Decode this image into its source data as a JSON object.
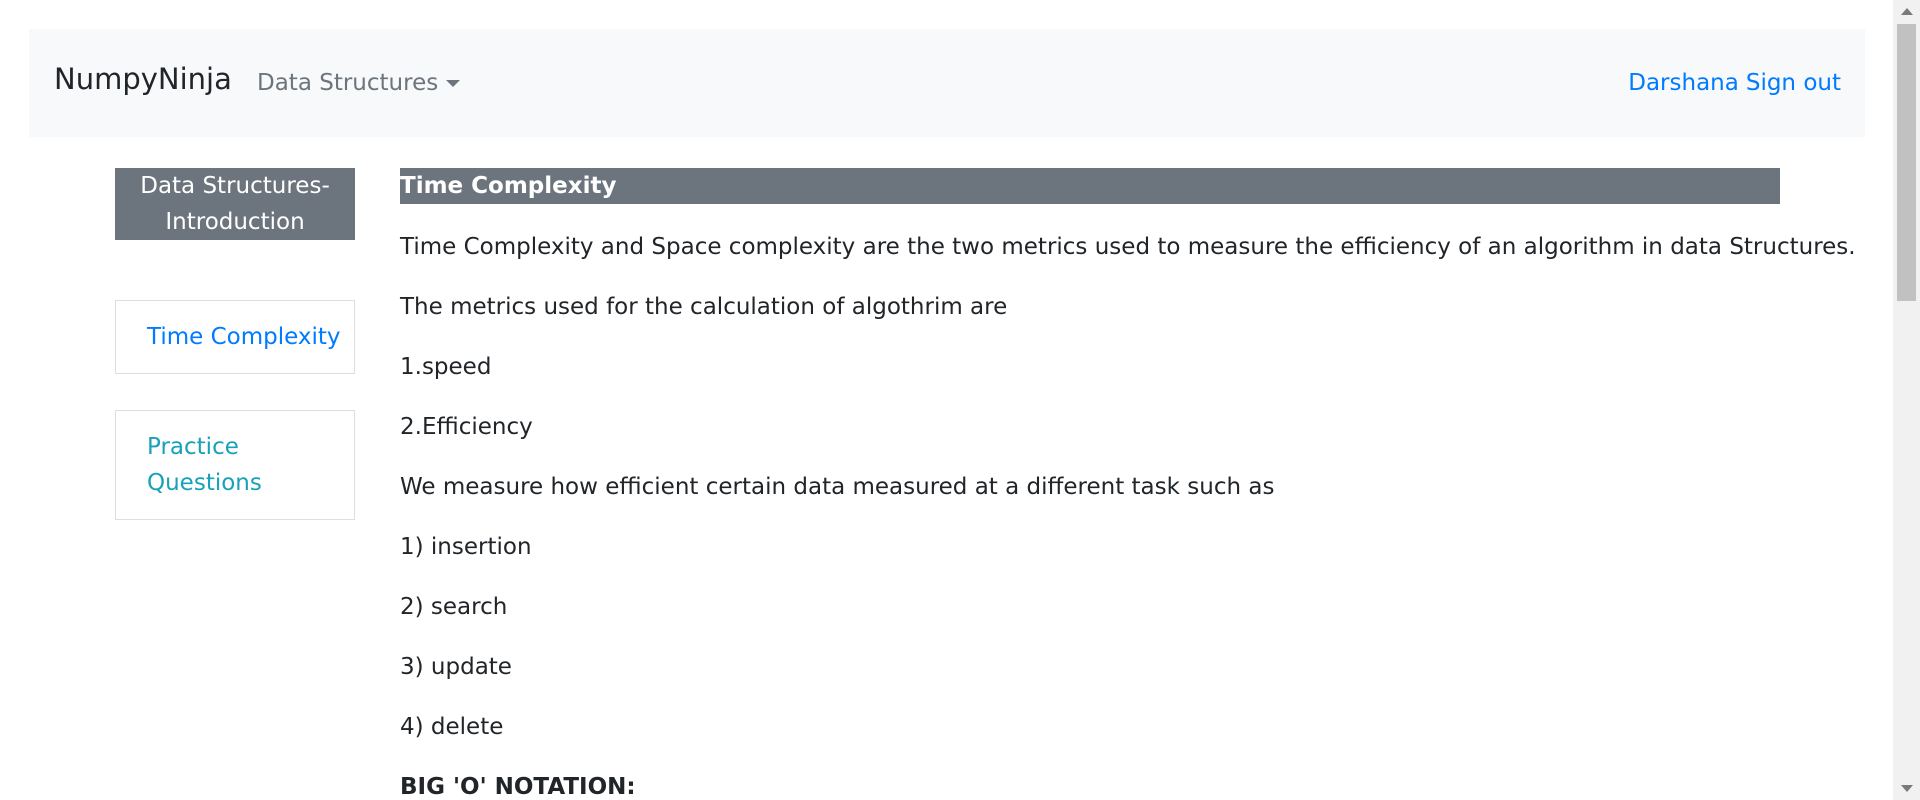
{
  "navbar": {
    "brand": "NumpyNinja",
    "dropdown_label": "Data Structures",
    "user_name": "Darshana",
    "sign_out": "Sign out"
  },
  "sidebar": {
    "header_line1": "Data Structures-",
    "header_line2": "Introduction",
    "items": [
      {
        "label": "Time Complexity"
      },
      {
        "label_line1": "Practice",
        "label_line2": "Questions"
      }
    ]
  },
  "content": {
    "title": "Time Complexity",
    "paragraphs": [
      "Time Complexity and Space complexity are the two metrics used to measure the efficiency of an algorithm in data Structures.",
      "The metrics used for the calculation of algothrim are",
      "1.speed",
      "2.Efficiency",
      "We measure how efficient certain data measured at a different task such as",
      "1) insertion",
      "2) search",
      "3) update",
      "4) delete",
      "BIG 'O' NOTATION:"
    ]
  },
  "colors": {
    "navbar_bg": "#f8f9fa",
    "header_bg": "#6c757d",
    "link_blue": "#007bff",
    "link_teal": "#17a2b8"
  }
}
